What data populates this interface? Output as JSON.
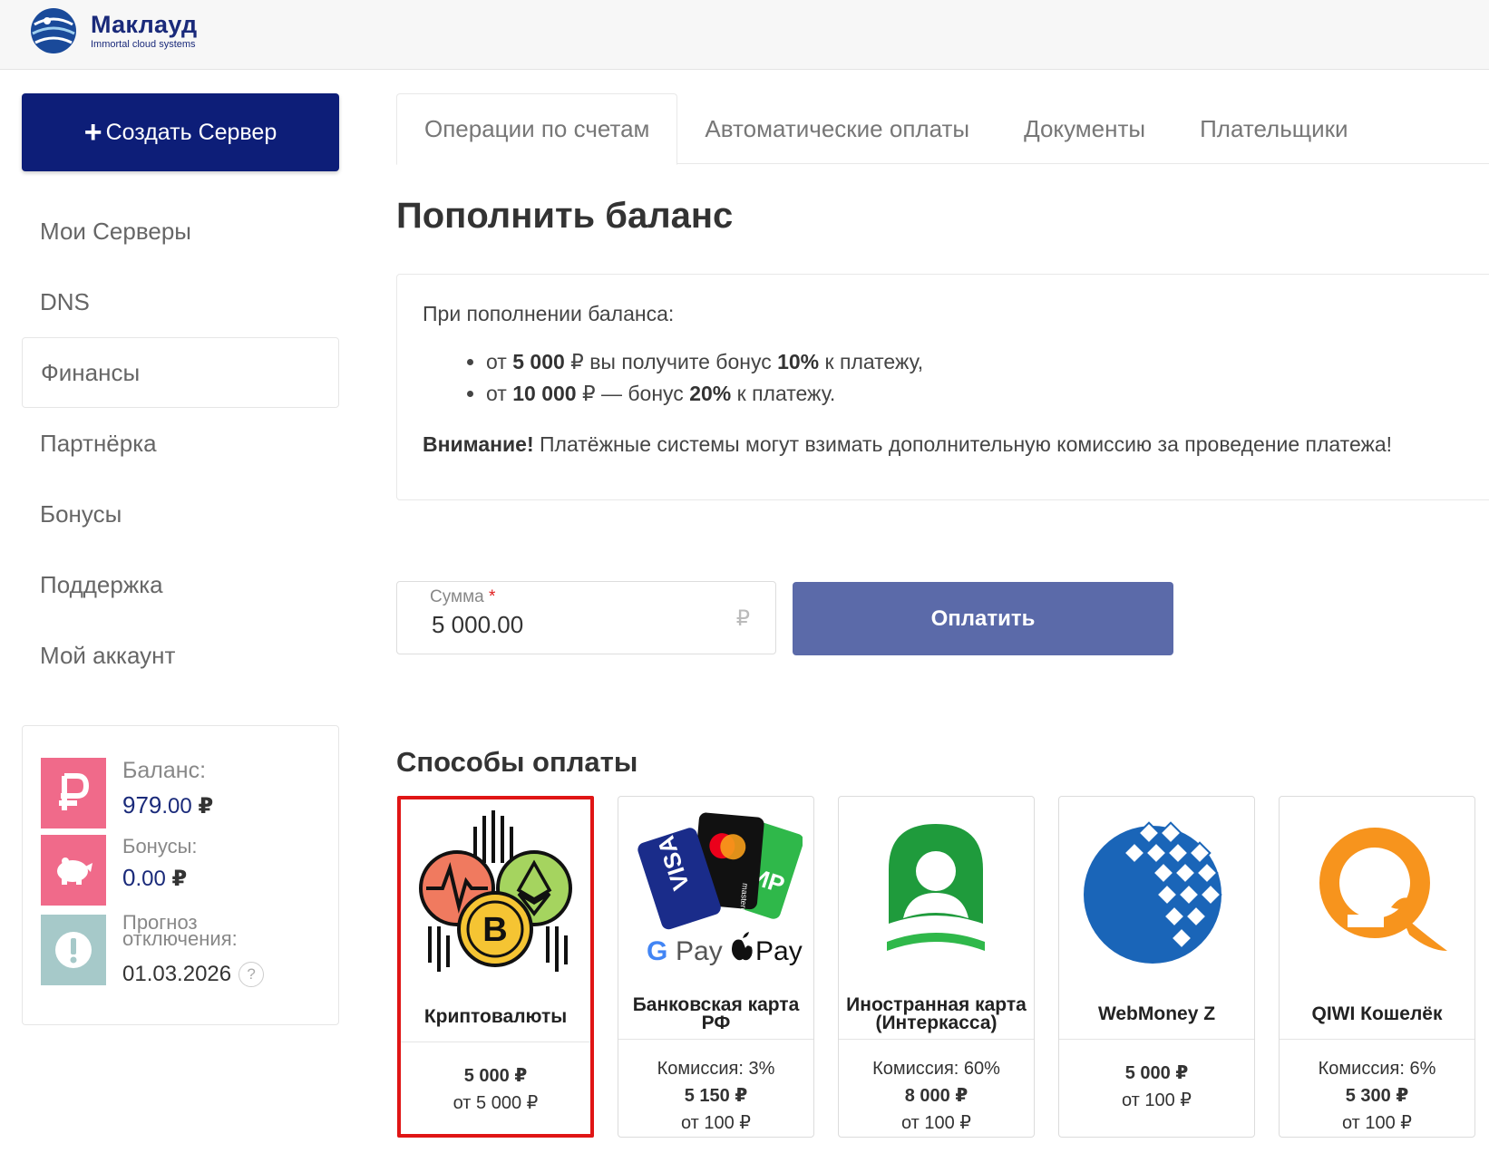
{
  "brand": {
    "name": "Маклауд",
    "tagline": "Immortal cloud systems"
  },
  "sidebar": {
    "create_label": "Создать Сервер",
    "items": [
      {
        "label": "Мои Серверы"
      },
      {
        "label": "DNS"
      },
      {
        "label": "Финансы",
        "active": true
      },
      {
        "label": "Партнёрка"
      },
      {
        "label": "Бонусы"
      },
      {
        "label": "Поддержка"
      },
      {
        "label": "Мой аккаунт"
      }
    ]
  },
  "account": {
    "balance_label": "Баланс:",
    "balance_int": "979",
    "balance_frac": ".00",
    "bonus_label": "Бонусы:",
    "bonus_int": "0",
    "bonus_frac": ".00",
    "currency": "₽",
    "forecast_label": "Прогноз отключения:",
    "forecast_date": "01.03.2026",
    "help_glyph": "?"
  },
  "tabs": [
    {
      "label": "Операции по счетам",
      "active": true
    },
    {
      "label": "Автоматические оплаты"
    },
    {
      "label": "Документы"
    },
    {
      "label": "Плательщики"
    }
  ],
  "page_title": "Пополнить баланс",
  "info": {
    "intro": "При пополнении баланса:",
    "b1_pre": "от ",
    "b1_amount": "5 000",
    "b1_mid": " ₽ вы получите бонус ",
    "b1_pct": "10%",
    "b1_post": " к платежу,",
    "b2_pre": "от ",
    "b2_amount": "10 000",
    "b2_mid": " ₽ — бонус ",
    "b2_pct": "20%",
    "b2_post": " к платежу.",
    "warn_bold": "Внимание!",
    "warn_text": " Платёжные системы могут взимать дополнительную комиссию за проведение платежа!"
  },
  "amount": {
    "label": "Сумма",
    "required_mark": "*",
    "value": "5 000.00",
    "currency": "₽"
  },
  "pay_button": "Оплатить",
  "methods_title": "Способы оплаты",
  "methods": [
    {
      "name": "Криптовалюты",
      "commission": "",
      "sum": "5 000 ₽",
      "min": "от 5 000 ₽",
      "selected": true,
      "icon": "crypto-icon"
    },
    {
      "name": "Банковская карта РФ",
      "commission": "Комиссия: 3%",
      "sum": "5 150 ₽",
      "min": "от 100 ₽",
      "icon": "bank-cards-icon"
    },
    {
      "name": "Иностранная карта (Интеркасса)",
      "commission": "Комиссия: 60%",
      "sum": "8 000 ₽",
      "min": "от 100 ₽",
      "icon": "interkassa-icon"
    },
    {
      "name": "WebMoney Z",
      "commission": "",
      "sum": "5 000 ₽",
      "min": "от 100 ₽",
      "icon": "webmoney-icon"
    },
    {
      "name": "QIWI Кошелёк",
      "commission": "Комиссия: 6%",
      "sum": "5 300 ₽",
      "min": "от 100 ₽",
      "icon": "qiwi-icon"
    }
  ],
  "gpay_labels": {
    "g": "G",
    "pay": "Pay",
    "apple_pay": "Pay"
  },
  "card_labels": {
    "visa": "VISA",
    "mastercard": "mastercard",
    "mir": "МИР"
  },
  "colors": {
    "primary": "#0d1e78",
    "pay_button": "#5b6aa9",
    "pink": "#f06a8a",
    "teal": "#a6c9c9",
    "selected_border": "#e01515"
  }
}
